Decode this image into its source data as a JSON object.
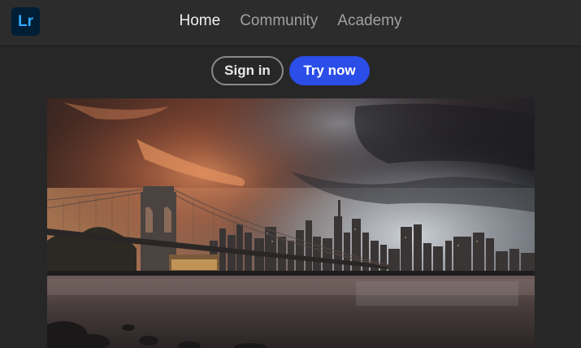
{
  "app": {
    "logo_text": "Lr",
    "logo_bg": "#001e36",
    "logo_color": "#31a8ff"
  },
  "nav": {
    "items": [
      {
        "label": "Home",
        "active": true
      },
      {
        "label": "Community",
        "active": false
      },
      {
        "label": "Academy",
        "active": false
      }
    ]
  },
  "actions": {
    "sign_in": "Sign in",
    "try_now": "Try now",
    "accent": "#2b4de8"
  },
  "hero": {
    "image": "brooklyn-bridge-skyline-photo"
  }
}
